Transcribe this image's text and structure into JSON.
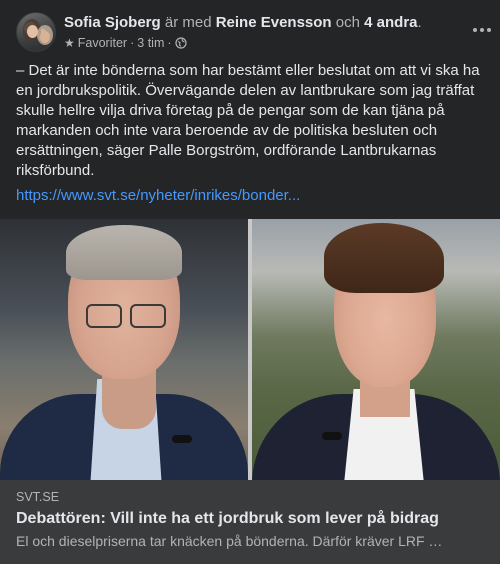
{
  "post": {
    "author": "Sofia Sjoberg",
    "with_text": " är med ",
    "tagged_person": "Reine Evensson",
    "and_text": " och ",
    "others": "4 andra",
    "period": ".",
    "audience_icon": "star-icon",
    "audience_label": "Favoriter",
    "separator": "·",
    "time": "3 tim",
    "privacy_icon": "globe-icon",
    "more_icon": "more-horizontal-icon",
    "text": "– Det är inte bönderna som har bestämt eller beslutat om att vi ska ha en jordbrukspolitik. Övervägande delen av lantbrukare som jag träffat skulle hellre vilja driva företag på de pengar som de kan tjäna på markanden och inte vara beroende av de politiska besluten och ersättningen, säger Palle Borgström, ordförande Lantbrukarnas riksförbund.",
    "url": "https://www.svt.se/nyheter/inrikes/bonder..."
  },
  "link_preview": {
    "source": "SVT.SE",
    "headline": "Debattören: Vill inte ha ett jordbruk som lever på bidrag",
    "description": "El och dieselpriserna tar knäcken på bönderna. Därför kräver LRF …"
  },
  "colors": {
    "background": "#242526",
    "preview_background": "#3a3b3c",
    "link": "#4599ff",
    "primary_text": "#e4e6eb",
    "secondary_text": "#b0b3b8"
  }
}
